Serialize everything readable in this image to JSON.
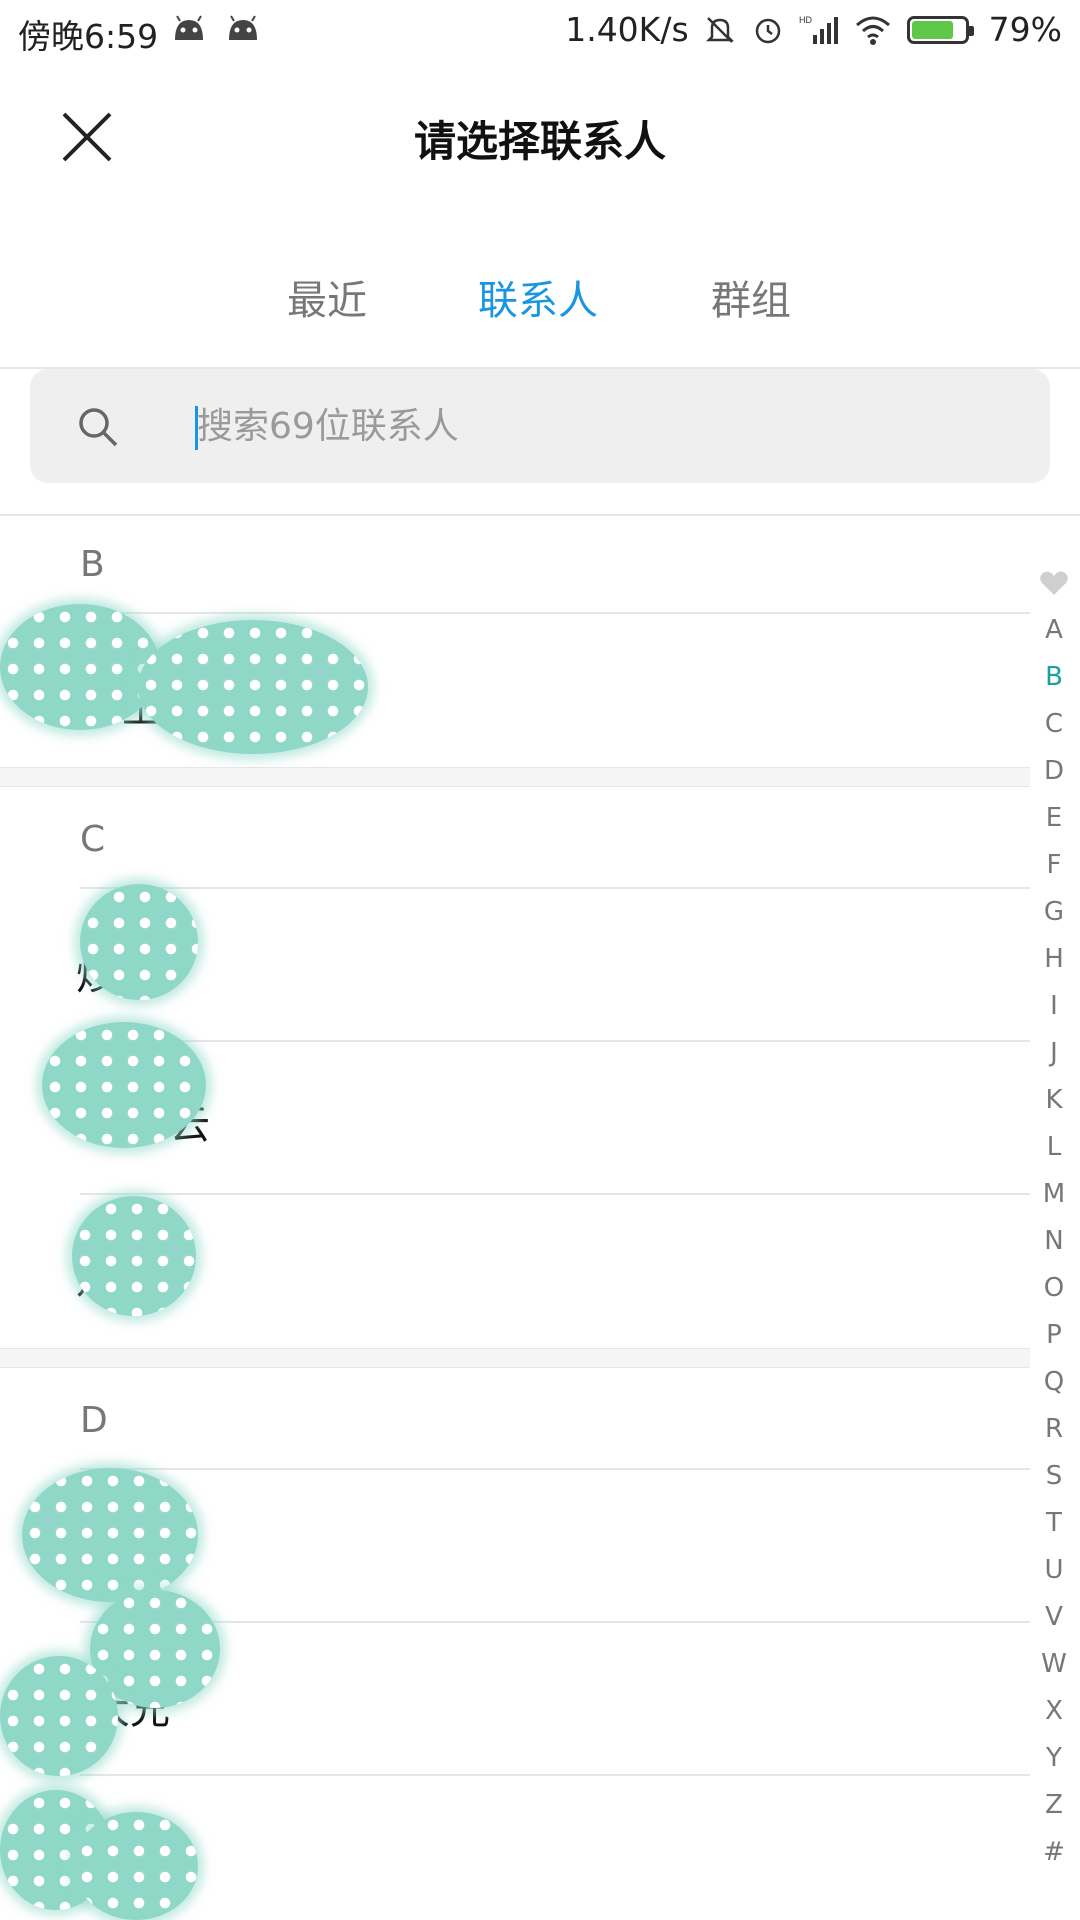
{
  "status_bar": {
    "time": "傍晚6:59",
    "speed": "1.40K/s",
    "battery": "79%",
    "battery_level": 0.79
  },
  "header": {
    "title": "请选择联系人"
  },
  "tabs": [
    {
      "label": "最近",
      "active": false
    },
    {
      "label": "联系人",
      "active": true
    },
    {
      "label": "群组",
      "active": false
    }
  ],
  "search": {
    "placeholder": "搜索69位联系人"
  },
  "sections": [
    {
      "letter": "B",
      "contacts": [
        "上"
      ]
    },
    {
      "letter": "C",
      "contacts": [
        "炒",
        "云",
        "凡"
      ]
    },
    {
      "letter": "D",
      "contacts": [
        "",
        "大兄",
        ""
      ]
    }
  ],
  "index": [
    "A",
    "B",
    "C",
    "D",
    "E",
    "F",
    "G",
    "H",
    "I",
    "J",
    "K",
    "L",
    "M",
    "N",
    "O",
    "P",
    "Q",
    "R",
    "S",
    "T",
    "U",
    "V",
    "W",
    "X",
    "Y",
    "Z",
    "#"
  ],
  "index_active": "B",
  "colors": {
    "accent": "#1a96e0",
    "index_active": "#1aa0a0",
    "blur_overlay": "#8fd8c8"
  }
}
